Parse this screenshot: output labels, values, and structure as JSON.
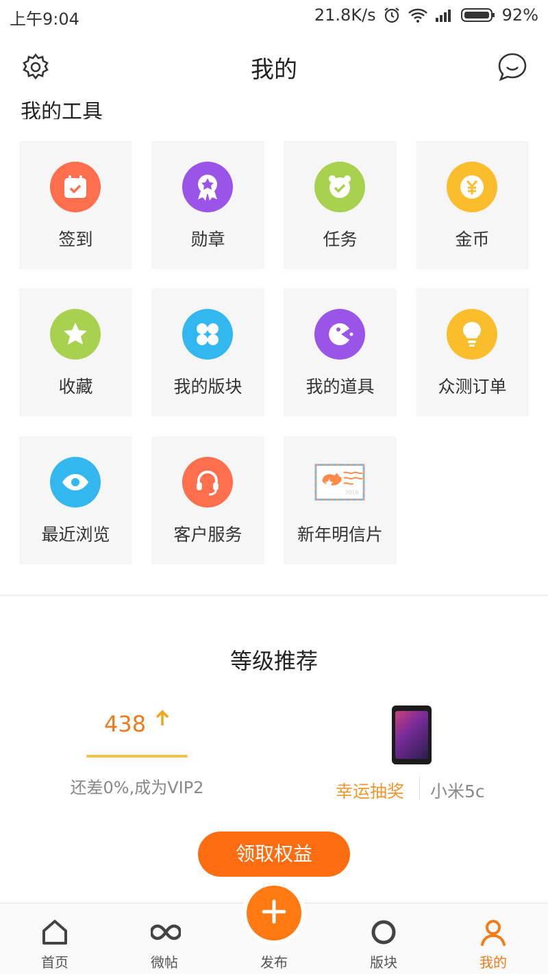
{
  "status_bar": {
    "time": "上午9:04",
    "speed": "21.8K/s",
    "battery": "92%"
  },
  "header": {
    "title": "我的"
  },
  "section": {
    "title": "我的工具"
  },
  "tools": [
    {
      "label": "签到",
      "icon": "calendar-check-icon",
      "color": "#ff6f4d"
    },
    {
      "label": "勋章",
      "icon": "medal-icon",
      "color": "#9a55e8"
    },
    {
      "label": "任务",
      "icon": "task-check-icon",
      "color": "#a7d14f"
    },
    {
      "label": "金币",
      "icon": "coin-icon",
      "color": "#fbbd2b"
    },
    {
      "label": "收藏",
      "icon": "star-icon",
      "color": "#a7d14f"
    },
    {
      "label": "我的版块",
      "icon": "blocks-icon",
      "color": "#33b7f0"
    },
    {
      "label": "我的道具",
      "icon": "props-icon",
      "color": "#9a55e8"
    },
    {
      "label": "众测订单",
      "icon": "bulb-icon",
      "color": "#fbbd2b"
    },
    {
      "label": "最近浏览",
      "icon": "eye-icon",
      "color": "#33b7f0"
    },
    {
      "label": "客户服务",
      "icon": "headset-icon",
      "color": "#ff6f4d"
    },
    {
      "label": "新年明信片",
      "icon": "postcard-icon",
      "color": "#ffffff"
    }
  ],
  "level": {
    "title": "等级推荐",
    "points": "438",
    "hint": "还差0%,成为VIP2",
    "prize_label": "幸运抽奖",
    "prize_name": "小米5c",
    "claim_label": "领取权益"
  },
  "nav": [
    {
      "label": "首页",
      "icon": "home-icon"
    },
    {
      "label": "微帖",
      "icon": "infinity-icon"
    },
    {
      "label": "发布",
      "icon": "plus-icon"
    },
    {
      "label": "版块",
      "icon": "circle-icon"
    },
    {
      "label": "我的",
      "icon": "user-icon",
      "active": true
    }
  ]
}
